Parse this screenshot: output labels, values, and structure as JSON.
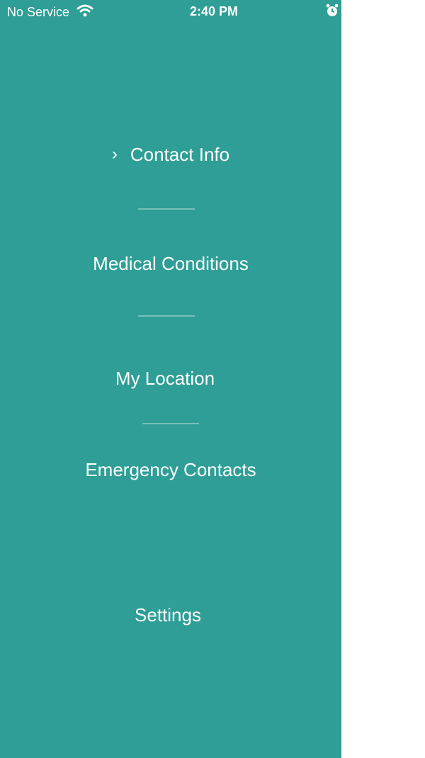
{
  "status_bar": {
    "carrier": "No Service",
    "time": "2:40 PM"
  },
  "menu": {
    "items": [
      {
        "label": "Contact Info",
        "selected": true
      },
      {
        "label": "Medical Conditions"
      },
      {
        "label": "My Location"
      },
      {
        "label": "Emergency Contacts"
      },
      {
        "label": "Settings"
      }
    ]
  },
  "colors": {
    "drawer_background": "#2e9e96",
    "text": "#ffffff"
  },
  "icons": {
    "status": [
      "wifi-icon",
      "alarm-icon"
    ],
    "selected_indicator": "chevron-right-icon"
  }
}
